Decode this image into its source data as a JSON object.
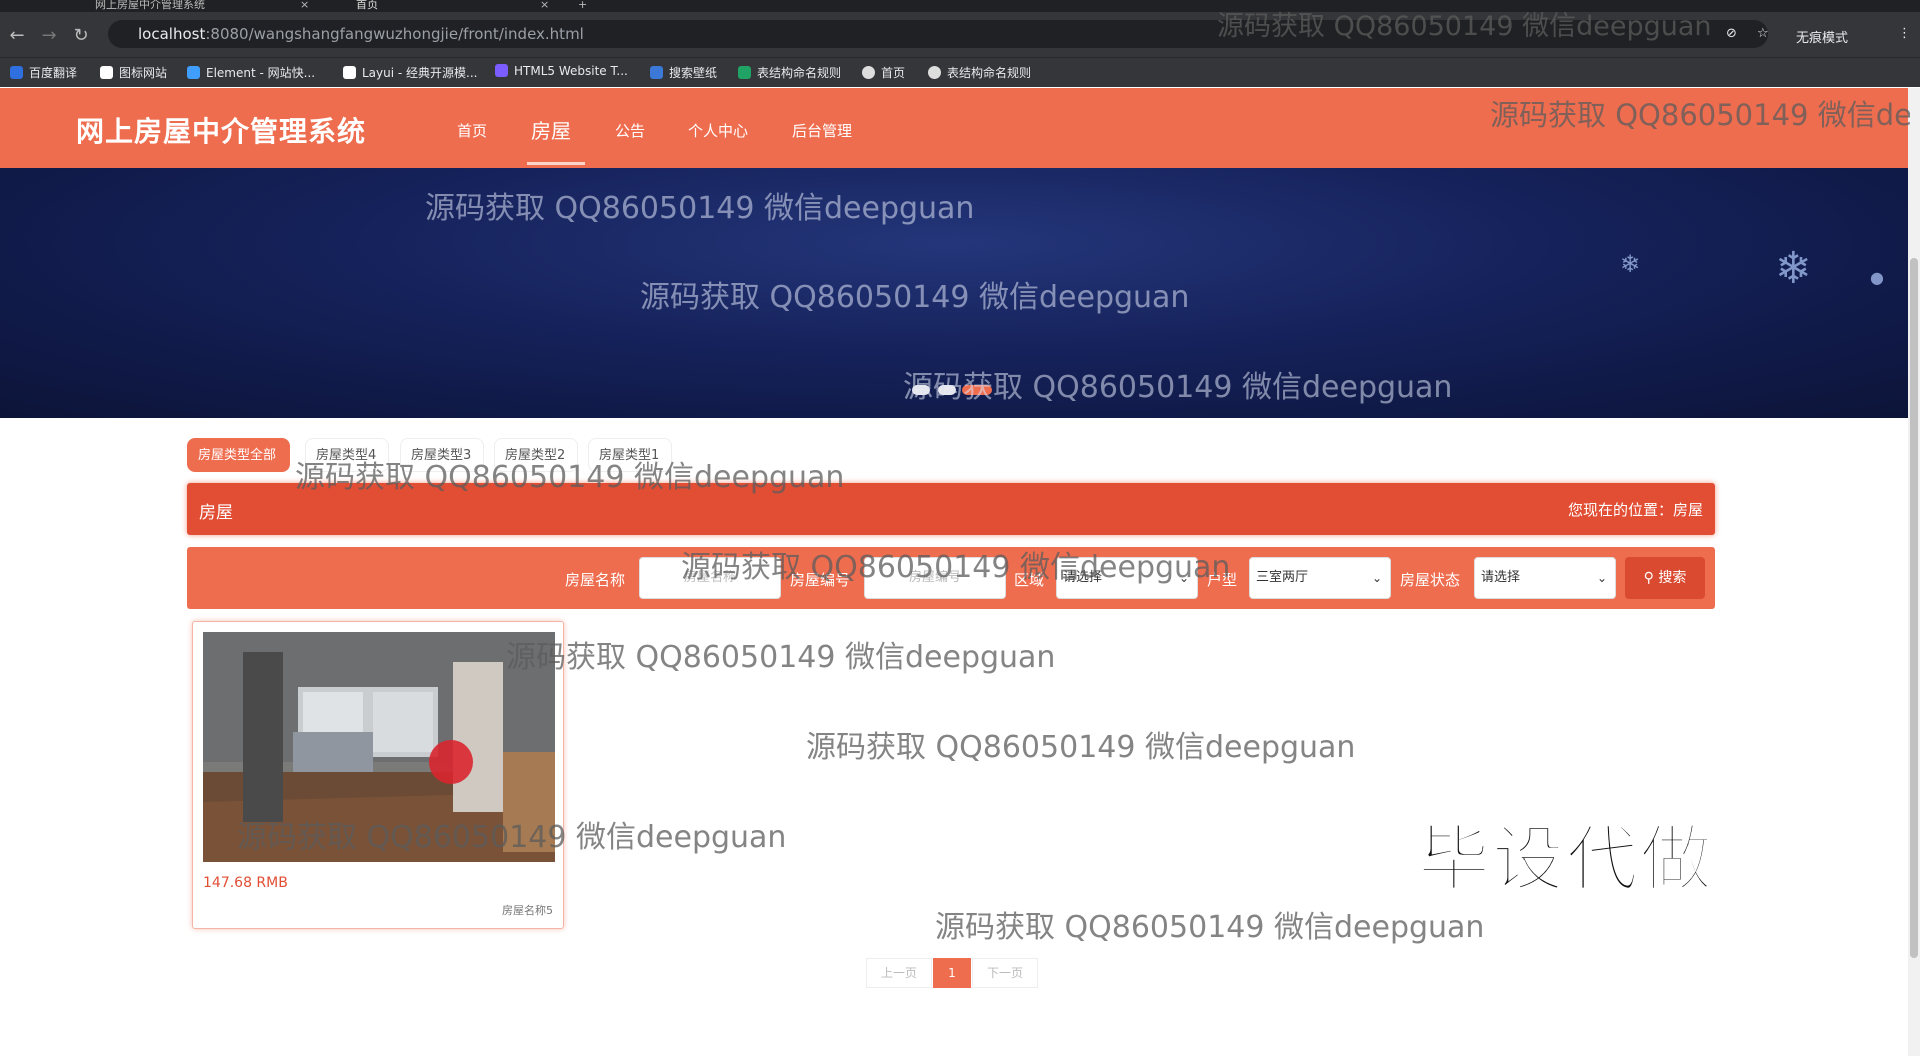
{
  "browser": {
    "tabs": [
      {
        "title": "网上房屋中介管理系统"
      },
      {
        "title": "首页"
      }
    ],
    "url_host": "localhost",
    "url_rest": ":8080/wangshangfangwuzhongjie/front/index.html",
    "incognito_label": "无痕模式",
    "bookmarks": [
      {
        "label": "百度翻译",
        "color": "#2f6fe0"
      },
      {
        "label": "图标网站",
        "color": "#ffffff"
      },
      {
        "label": "Element - 网站快...",
        "color": "#409eff"
      },
      {
        "label": "Layui - 经典开源模...",
        "color": "#ffffff"
      },
      {
        "label": "HTML5 Website T...",
        "color": "#7a5cff"
      },
      {
        "label": "搜索壁纸",
        "color": "#3c78d8"
      },
      {
        "label": "表结构命名规则",
        "color": "#21a366"
      },
      {
        "label": "首页",
        "color": "#dddddd"
      },
      {
        "label": "表结构命名规则",
        "color": "#dddddd"
      }
    ]
  },
  "site": {
    "title": "网上房屋中介管理系统",
    "nav": [
      "首页",
      "房屋",
      "公告",
      "个人中心",
      "后台管理"
    ],
    "active_nav": "房屋",
    "brand_color": "#ef6d4f"
  },
  "type_tabs": [
    "房屋类型全部",
    "房屋类型4",
    "房屋类型3",
    "房屋类型2",
    "房屋类型1"
  ],
  "section": {
    "title": "房屋",
    "location": "您现在的位置：房屋"
  },
  "search": {
    "name_label": "房屋名称",
    "name_placeholder": "房屋名称",
    "code_label": "房屋编号",
    "code_placeholder": "房屋编号",
    "area_label": "区域",
    "area_value": "请选择",
    "layout_label": "户型",
    "layout_value": "三室两厅",
    "status_label": "房屋状态",
    "status_value": "请选择",
    "button": "搜索"
  },
  "listings": [
    {
      "price": "147.68 RMB",
      "name": "房屋名称5"
    }
  ],
  "pagination": {
    "prev": "上一页",
    "current": "1",
    "next": "下一页"
  },
  "watermark": "源码获取 QQ86050149 微信deepguan",
  "promo": "毕设代做"
}
